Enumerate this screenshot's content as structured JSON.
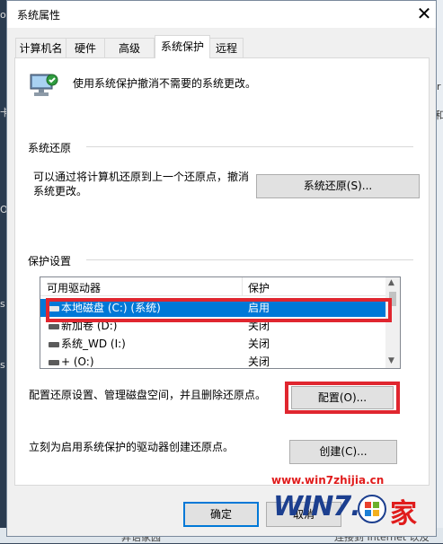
{
  "window": {
    "title": "系统属性"
  },
  "tabs": [
    {
      "label": "计算机名",
      "active": false
    },
    {
      "label": "硬件",
      "active": false
    },
    {
      "label": "高级",
      "active": false
    },
    {
      "label": "系统保护",
      "active": true
    },
    {
      "label": "远程",
      "active": false
    }
  ],
  "intro": "使用系统保护撤消不需要的系统更改。",
  "restore": {
    "heading": "系统还原",
    "description": "可以通过将计算机还原到上一个还原点，撤消系统更改。",
    "button": "系统还原(S)..."
  },
  "protection": {
    "heading": "保护设置",
    "columns": [
      "可用驱动器",
      "保护"
    ],
    "rows": [
      {
        "drive": "本地磁盘 (C:) (系统)",
        "status": "启用",
        "selected": true
      },
      {
        "drive": "新加卷 (D:)",
        "status": "关闭",
        "selected": false
      },
      {
        "drive": "系统_WD (I:)",
        "status": "关闭",
        "selected": false
      },
      {
        "drive": "+ (O:)",
        "status": "关闭",
        "selected": false
      }
    ],
    "configure_text": "配置还原设置、管理磁盘空间，并且删除还原点。",
    "configure_button": "配置(O)...",
    "create_text": "立刻为启用系统保护的驱动器创建还原点。",
    "create_button": "创建(C)..."
  },
  "footer": {
    "ok": "确定",
    "cancel": "取消"
  },
  "watermark": {
    "url": "www.win7zhijia.cn",
    "logo": "WIN7.",
    "logo_suffix": "家"
  },
  "background": {
    "bottom_left": "异语家园",
    "bottom_right": "连接到 Internet 以及",
    "left_edge": [
      "o",
      "卡",
      "ON",
      "s",
      "s"
    ],
    "right_edge": [
      "r",
      "和"
    ]
  },
  "colors": {
    "accent": "#0078d7",
    "highlight_red": "#e0262f",
    "watermark_red": "#e01c1c"
  }
}
